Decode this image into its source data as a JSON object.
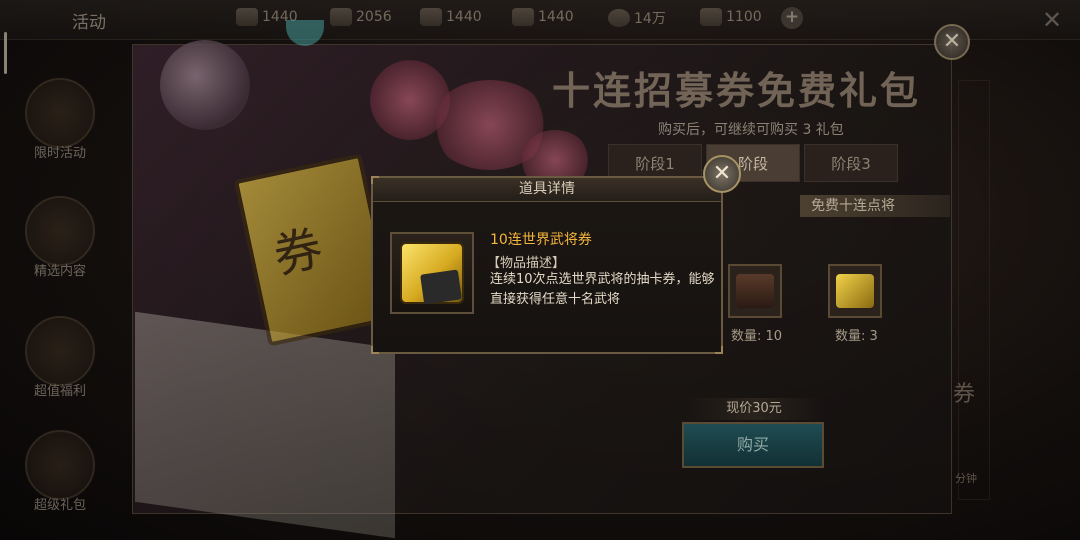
{
  "topbar": {
    "title": "活动",
    "resources": [
      {
        "icon": "soldier-icon",
        "value": "1440"
      },
      {
        "icon": "horse-icon",
        "value": "2056"
      },
      {
        "icon": "shield-icon",
        "value": "1440"
      },
      {
        "icon": "chariot-icon",
        "value": "1440"
      },
      {
        "icon": "coin-icon",
        "value": "14万"
      },
      {
        "icon": "ingot-icon",
        "value": "1100"
      }
    ],
    "plus_label": "+"
  },
  "sidebar": {
    "items": [
      {
        "label": "限时活动"
      },
      {
        "label": "精选内容"
      },
      {
        "label": "超值福利"
      },
      {
        "label": "超级礼包"
      }
    ]
  },
  "panel": {
    "title": "十连招募券免费礼包",
    "subtitle": "购买后，可继续可购买 3 礼包",
    "tabs": [
      {
        "label": "阶段1",
        "active": false
      },
      {
        "label": "阶段",
        "active": true
      },
      {
        "label": "阶段3",
        "active": false
      }
    ],
    "ribbon": "免费十连点将",
    "rewards": [
      {
        "quantity_label": "数量: 10"
      },
      {
        "quantity_label": "数量: 3"
      }
    ],
    "price_label": "现价30元",
    "buy_label": "购买",
    "right_deco_text": "券",
    "right_deco_sub": "分钟"
  },
  "dialog": {
    "title": "道具详情",
    "item_name": "10连世界武将券",
    "desc_title": "【物品描述】",
    "desc_body": "连续10次点选世界武将的抽卡券，能够直接获得任意十名武将"
  },
  "colors": {
    "item_name": "#f3b53c",
    "frame_gold": "#6a5a40",
    "button_teal": "#1f4c52"
  }
}
